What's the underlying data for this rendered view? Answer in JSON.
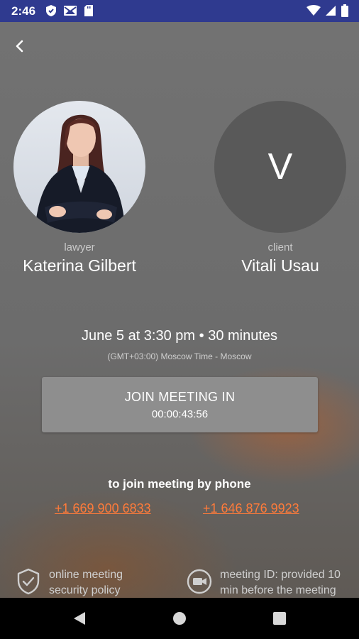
{
  "status_bar": {
    "time": "2:46",
    "left_icons": [
      "shield-icon",
      "mail-icon",
      "sd-card-icon"
    ],
    "right_icons": [
      "wifi-icon",
      "signal-icon",
      "battery-icon"
    ],
    "background": "#2f3a8f"
  },
  "header": {
    "back_icon": "chevron-left-icon"
  },
  "participants": {
    "lawyer": {
      "role": "lawyer",
      "name": "Katerina Gilbert",
      "avatar": "photo"
    },
    "client": {
      "role": "client",
      "name": "Vitali Usau",
      "initial": "V"
    }
  },
  "meeting": {
    "schedule": "June 5 at 3:30 pm • 30 minutes",
    "timezone": "(GMT+03:00) Moscow Time - Moscow",
    "join_label": "JOIN MEETING IN",
    "countdown": "00:00:43:56"
  },
  "phone": {
    "title": "to join meeting by phone",
    "numbers": [
      "+1 669 900 6833",
      "+1 646 876 9923"
    ],
    "link_color": "#ff7b3a"
  },
  "info": {
    "security": {
      "icon": "shield-check-icon",
      "text": "online meeting security policy"
    },
    "meeting_id": {
      "icon": "video-camera-icon",
      "text": "meeting ID: provided 10 min before the meeting"
    }
  },
  "nav": {
    "icons": [
      "back-triangle-icon",
      "home-circle-icon",
      "recents-square-icon"
    ]
  }
}
